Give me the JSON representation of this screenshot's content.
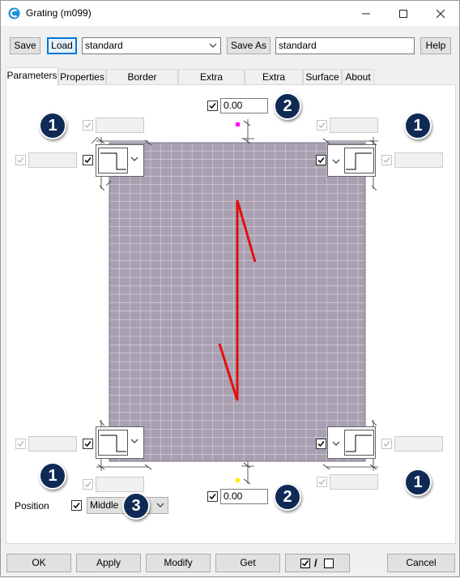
{
  "window": {
    "title": "Grating (m099)"
  },
  "toolbar": {
    "save_label": "Save",
    "load_label": "Load",
    "preset_value": "standard",
    "save_as_label": "Save As",
    "save_as_value": "standard",
    "help_label": "Help"
  },
  "tabs": [
    {
      "label": "Parameters"
    },
    {
      "label": "Properties"
    },
    {
      "label": "Border openings"
    },
    {
      "label": "Extra openings"
    },
    {
      "label": "Extra profiles"
    },
    {
      "label": "Surface"
    },
    {
      "label": "About"
    }
  ],
  "parameters": {
    "top_offset": "0.00",
    "bottom_offset": "0.00",
    "position_label": "Position",
    "position_value": "Middle"
  },
  "badges": {
    "one": "1",
    "two": "2",
    "three": "3"
  },
  "footer": {
    "ok_label": "OK",
    "apply_label": "Apply",
    "modify_label": "Modify",
    "get_label": "Get",
    "toggle_separator": "/",
    "cancel_label": "Cancel"
  },
  "colors": {
    "grating_fill": "#a89fb0",
    "grid_line": "#e8e4ec",
    "arrow": "#e11010",
    "marker_top": "#ff00ff",
    "marker_bottom": "#ffee00",
    "badge": "#0f2a55"
  }
}
